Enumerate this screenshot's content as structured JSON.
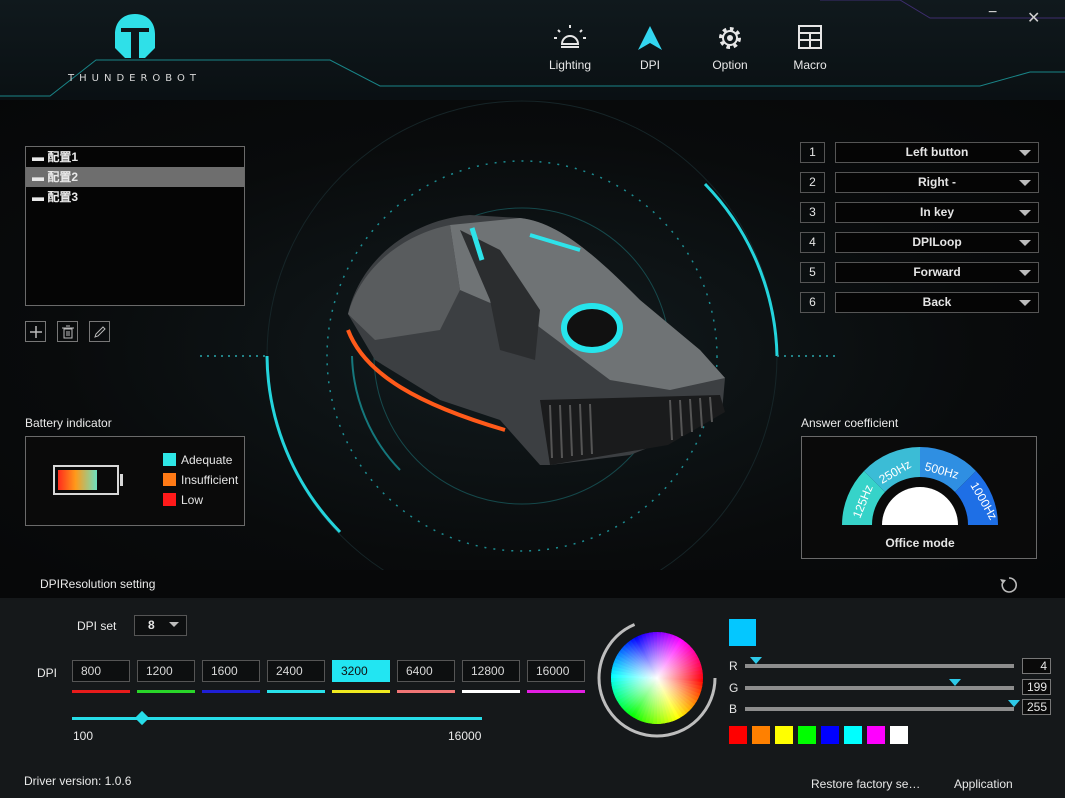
{
  "app": {
    "logo_text": "THUNDEROBOT"
  },
  "nav": [
    {
      "label": "Lighting",
      "icon": "bulb-icon"
    },
    {
      "label": "DPI",
      "icon": "arrow-up-icon"
    },
    {
      "label": "Option",
      "icon": "gear-icon"
    },
    {
      "label": "Macro",
      "icon": "grid-icon"
    }
  ],
  "window": {
    "minimize": "−",
    "close": "✕"
  },
  "profiles": {
    "items": [
      "配置1",
      "配置2",
      "配置3"
    ],
    "selected": 1
  },
  "tools": [
    "add-icon",
    "delete-icon",
    "edit-icon"
  ],
  "battery": {
    "title": "Battery indicator",
    "legend": [
      {
        "label": "Adequate",
        "color": "#2ee6e6"
      },
      {
        "label": "Insufficient",
        "color": "#ff7a16"
      },
      {
        "label": "Low",
        "color": "#ff1a1a"
      }
    ]
  },
  "buttons": [
    {
      "num": "1",
      "value": "Left button"
    },
    {
      "num": "2",
      "value": "Right -"
    },
    {
      "num": "3",
      "value": "In key"
    },
    {
      "num": "4",
      "value": "DPILoop"
    },
    {
      "num": "5",
      "value": "Forward"
    },
    {
      "num": "6",
      "value": "Back"
    }
  ],
  "answer": {
    "title": "Answer coefficient",
    "rates": [
      "125Hz",
      "250Hz",
      "500Hz",
      "1000Hz"
    ],
    "mode": "Office mode"
  },
  "dpi_section": {
    "title": "DPIResolution setting",
    "dpi_set_label": "DPI set",
    "dpi_set_value": "8",
    "dpi_label": "DPI",
    "levels": [
      {
        "value": "800",
        "color": "#e81b1b"
      },
      {
        "value": "1200",
        "color": "#29d629"
      },
      {
        "value": "1600",
        "color": "#1f1fd6"
      },
      {
        "value": "2400",
        "color": "#28e1ea"
      },
      {
        "value": "3200",
        "color": "#f0ea1f"
      },
      {
        "value": "6400",
        "color": "#f07575"
      },
      {
        "value": "12800",
        "color": "#ffffff"
      },
      {
        "value": "16000",
        "color": "#e31ee3"
      }
    ],
    "active_index": 4,
    "slider_min": "100",
    "slider_max": "16000",
    "slider_fraction": 0.17
  },
  "color": {
    "current": "#04c7ff",
    "r": {
      "label": "R",
      "value": "4",
      "fraction": 0.04
    },
    "g": {
      "label": "G",
      "value": "199",
      "fraction": 0.78
    },
    "b": {
      "label": "B",
      "value": "255",
      "fraction": 1.0
    },
    "presets": [
      "#ff0000",
      "#ff8000",
      "#ffff00",
      "#00ff00",
      "#0000ff",
      "#00ffff",
      "#ff00ff",
      "#ffffff"
    ]
  },
  "footer": {
    "driver": "Driver version: 1.0.6",
    "restore": "Restore factory se…",
    "apply": "Application"
  }
}
